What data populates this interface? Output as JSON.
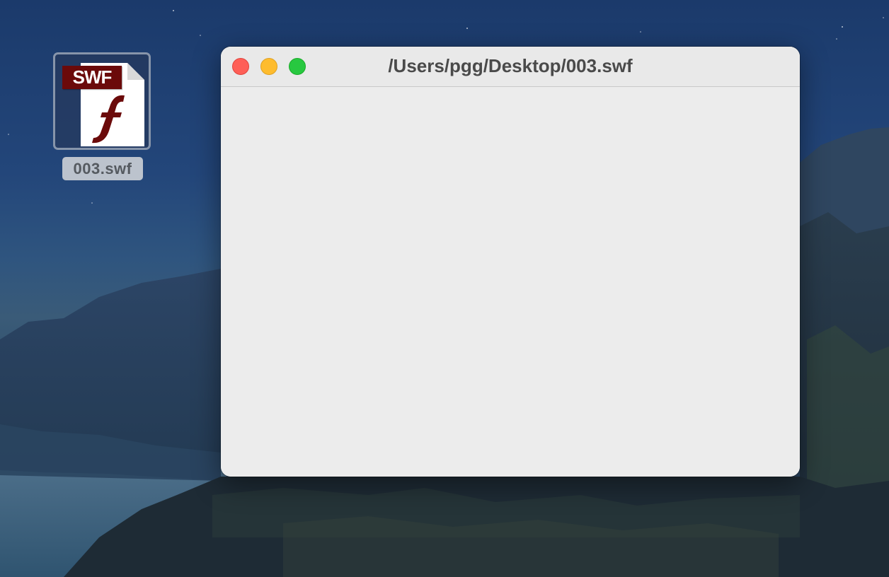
{
  "desktop": {
    "icon": {
      "badge": "SWF",
      "label": "003.swf",
      "icon_name": "flash-swf-file-icon",
      "badge_color": "#6b0a0a"
    }
  },
  "window": {
    "title": "/Users/pgg/Desktop/003.swf",
    "controls": {
      "close_color": "#fe5f57",
      "minimize_color": "#febc2e",
      "zoom_color": "#28c840"
    }
  }
}
